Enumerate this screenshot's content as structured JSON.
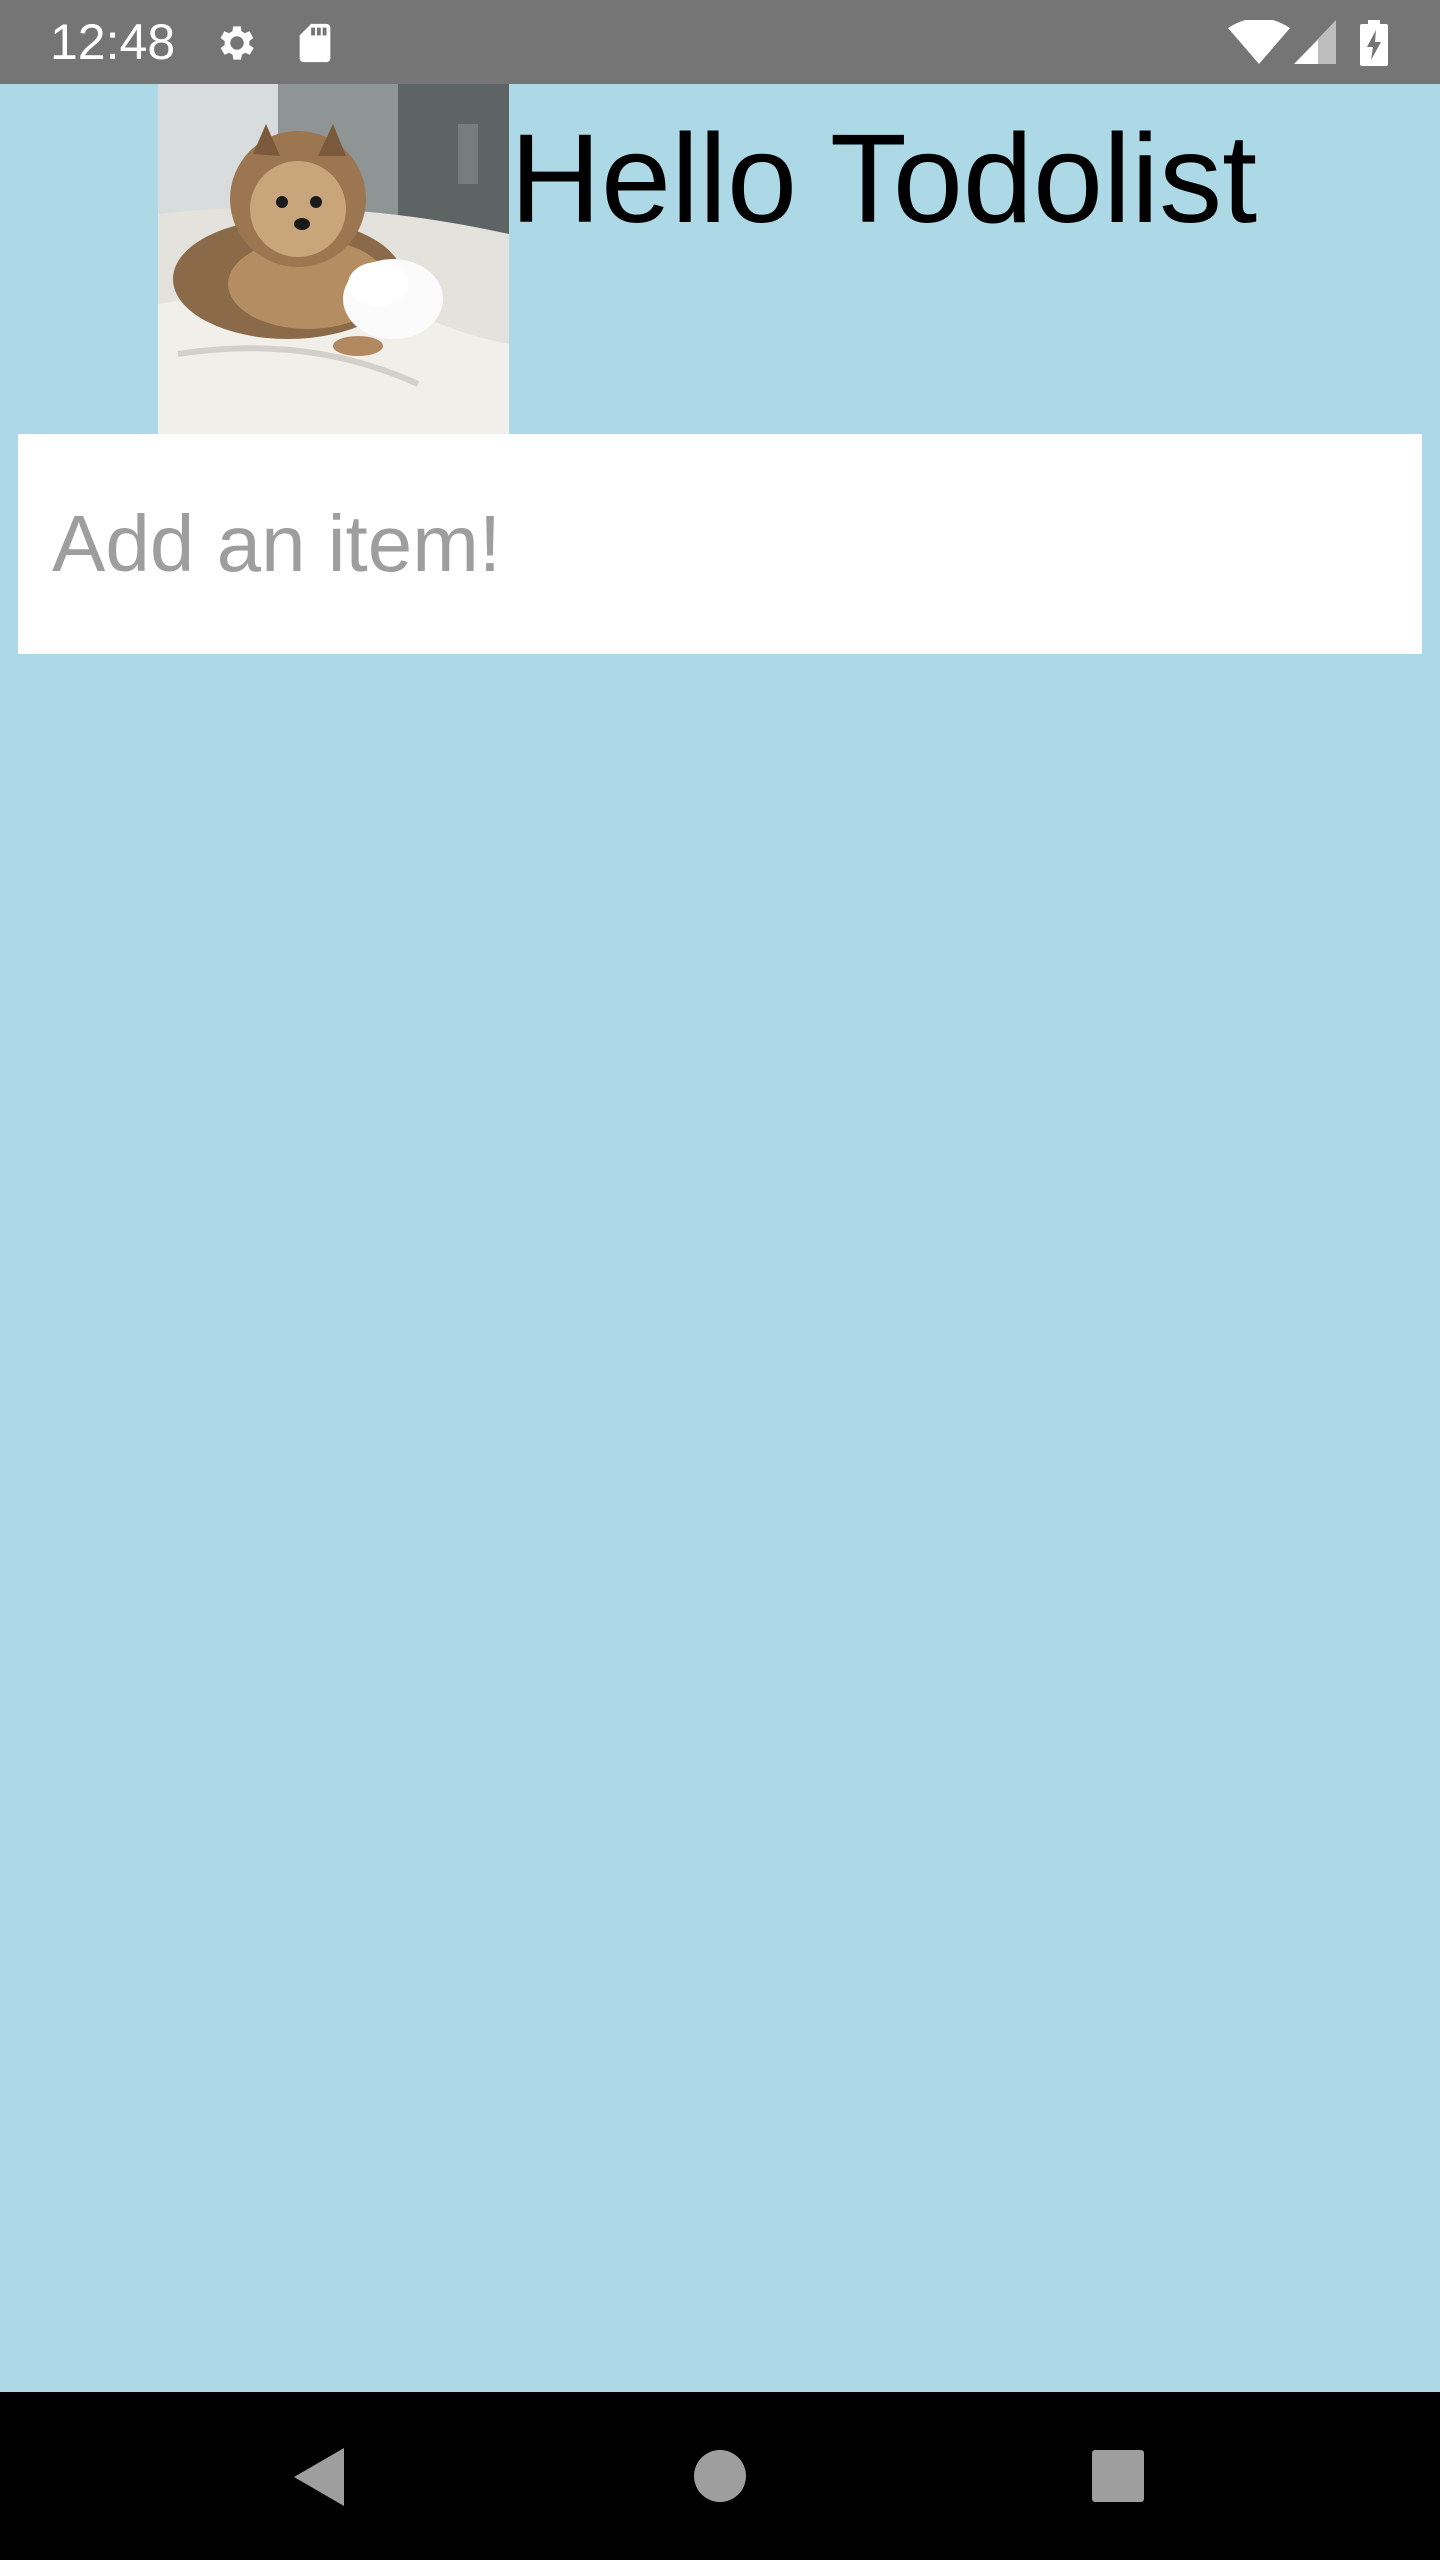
{
  "colors": {
    "status_bar_bg": "#757575",
    "app_bg": "#add8e6",
    "input_bg": "#ffffff",
    "nav_bar_bg": "#000000",
    "nav_icon": "#9e9e9e",
    "title_text": "#000000",
    "placeholder_text": "#9e9e9e"
  },
  "status_bar": {
    "time": "12:48",
    "left_icons": [
      "gear-icon",
      "sd-card-icon"
    ],
    "right_icons": [
      "wifi-icon",
      "cell-signal-icon",
      "battery-charging-icon"
    ]
  },
  "header": {
    "image_icon": "pomeranian-dog-photo",
    "title": "Hello Todolist"
  },
  "add_item": {
    "value": "",
    "placeholder": "Add an item!"
  },
  "nav_bar": {
    "buttons": [
      "back-icon",
      "home-icon",
      "recents-icon"
    ]
  }
}
